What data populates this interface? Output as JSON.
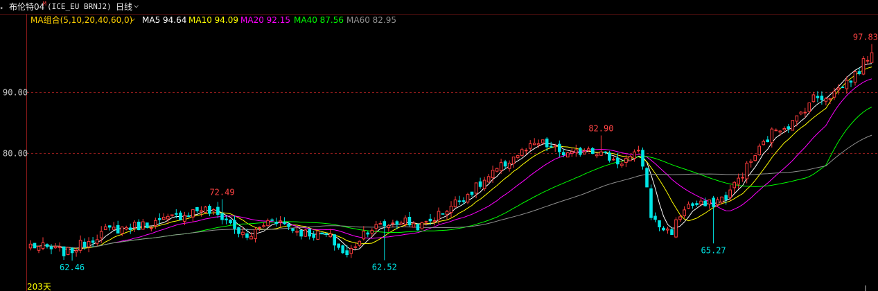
{
  "header": {
    "instrument": "布伦特04",
    "instrument_sup": "M",
    "code": "(ICE_EU BRNJ2)",
    "period": "日线",
    "dropdown_glyph": "⌵"
  },
  "ma_legend": {
    "group_label": "MA组合(5,10,20,40,60,0)",
    "group_glyph": "⌵",
    "items": [
      {
        "label": "MA5 94.64",
        "color": "#ffffff"
      },
      {
        "label": "MA10 94.09",
        "color": "#ffff00"
      },
      {
        "label": "MA20 92.15",
        "color": "#ff00ff"
      },
      {
        "label": "MA40 87.56",
        "color": "#00ff00"
      },
      {
        "label": "MA60 82.95",
        "color": "#909090"
      }
    ]
  },
  "colors": {
    "up": "#ff3c3c",
    "down": "#00e5e5",
    "grid": "#8b1a1a",
    "annotation_high": "#ff4444",
    "annotation_low": "#00e5e5",
    "ma5": "#ffffff",
    "ma10": "#ffff00",
    "ma20": "#ff00ff",
    "ma40": "#00ff00",
    "ma60": "#909090"
  },
  "chart_data": {
    "type": "candlestick",
    "ylim": [
      57.5,
      100.5
    ],
    "y_ticks": [
      {
        "value": 90,
        "label": "90.00"
      },
      {
        "value": 80,
        "label": "80.00"
      }
    ],
    "bar_count": 203,
    "bar_count_label": "203天",
    "annotations": [
      {
        "label": "72.49",
        "index": 46,
        "value": 72.49,
        "kind": "high"
      },
      {
        "label": "62.46",
        "index": 10,
        "value": 62.46,
        "kind": "low"
      },
      {
        "label": "62.52",
        "index": 85,
        "value": 62.52,
        "kind": "low"
      },
      {
        "label": "82.90",
        "index": 137,
        "value": 82.9,
        "kind": "high"
      },
      {
        "label": "65.27",
        "index": 164,
        "value": 65.27,
        "kind": "low"
      },
      {
        "label": "97.83",
        "index": 202,
        "value": 97.83,
        "kind": "high"
      }
    ],
    "keypoints": [
      [
        0,
        65.0
      ],
      [
        10,
        63.8
      ],
      [
        20,
        67.3
      ],
      [
        35,
        68.8
      ],
      [
        46,
        71.0
      ],
      [
        52,
        69.5
      ],
      [
        58,
        66.0
      ],
      [
        65,
        69.5
      ],
      [
        72,
        67.2
      ],
      [
        80,
        66.5
      ],
      [
        85,
        63.2
      ],
      [
        90,
        67.5
      ],
      [
        100,
        69.0
      ],
      [
        105,
        68.0
      ],
      [
        112,
        71.0
      ],
      [
        120,
        74.5
      ],
      [
        130,
        79.5
      ],
      [
        137,
        81.7
      ],
      [
        145,
        79.5
      ],
      [
        150,
        81.0
      ],
      [
        158,
        78.5
      ],
      [
        164,
        80.0
      ],
      [
        167,
        69.0
      ],
      [
        172,
        67.0
      ],
      [
        176,
        71.5
      ],
      [
        182,
        71.5
      ],
      [
        187,
        73.0
      ],
      [
        195,
        80.0
      ],
      [
        200,
        84.0
      ],
      [
        205,
        85.0
      ],
      [
        210,
        89.0
      ],
      [
        215,
        89.5
      ],
      [
        222,
        93.0
      ],
      [
        226,
        96.8
      ]
    ],
    "final_ma": {
      "ma5": 94.64,
      "ma10": 94.09,
      "ma20": 92.15,
      "ma40": 87.56,
      "ma60": 82.95
    }
  }
}
